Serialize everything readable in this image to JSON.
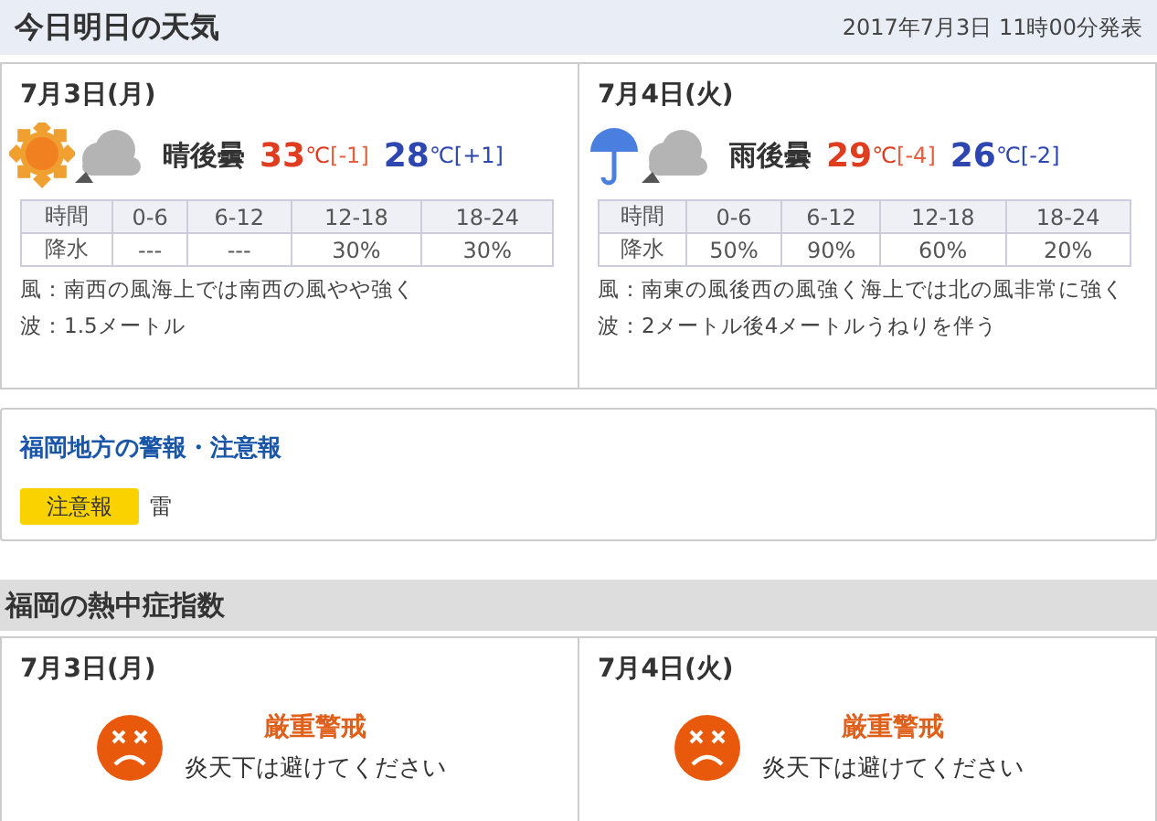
{
  "header": {
    "title": "今日明日の天気",
    "issued": "2017年7月3日 11時00分発表"
  },
  "forecasts": [
    {
      "date": "7月3日(月)",
      "icons": [
        {
          "kind": "sun"
        },
        {
          "kind": "cloud"
        }
      ],
      "weather": "晴後曇",
      "high": "33",
      "high_unit": "℃",
      "high_diff": "[-1]",
      "low": "28",
      "low_unit": "℃",
      "low_diff": "[+1]",
      "table": {
        "rows": [
          [
            "時間",
            "0-6",
            "6-12",
            "12-18",
            "18-24"
          ],
          [
            "降水",
            "---",
            "---",
            "30%",
            "30%"
          ]
        ]
      },
      "wind": "風：南西の風海上では南西の風やや強く",
      "wave": "波：1.5メートル"
    },
    {
      "date": "7月4日(火)",
      "icons": [
        {
          "kind": "umbrella"
        },
        {
          "kind": "cloud"
        }
      ],
      "weather": "雨後曇",
      "high": "29",
      "high_unit": "℃",
      "high_diff": "[-4]",
      "low": "26",
      "low_unit": "℃",
      "low_diff": "[-2]",
      "table": {
        "rows": [
          [
            "時間",
            "0-6",
            "6-12",
            "12-18",
            "18-24"
          ],
          [
            "降水",
            "50%",
            "90%",
            "60%",
            "20%"
          ]
        ]
      },
      "wind": "風：南東の風後西の風強く海上では北の風非常に強く",
      "wave": "波：2メートル後4メートルうねりを伴う"
    }
  ],
  "warnings": {
    "title": "福岡地方の警報・注意報",
    "items": [
      {
        "badge": "注意報",
        "color": "#fad200",
        "text": "雷"
      }
    ]
  },
  "heatstroke": {
    "title": "福岡の熱中症指数",
    "days": [
      {
        "date": "7月3日(月)",
        "icon": {
          "kind": "sad_face"
        },
        "level": "厳重警戒",
        "advice": "炎天下は避けてください"
      },
      {
        "date": "7月4日(火)",
        "icon": {
          "kind": "sad_face"
        },
        "level": "厳重警戒",
        "advice": "炎天下は避けてください"
      }
    ]
  }
}
